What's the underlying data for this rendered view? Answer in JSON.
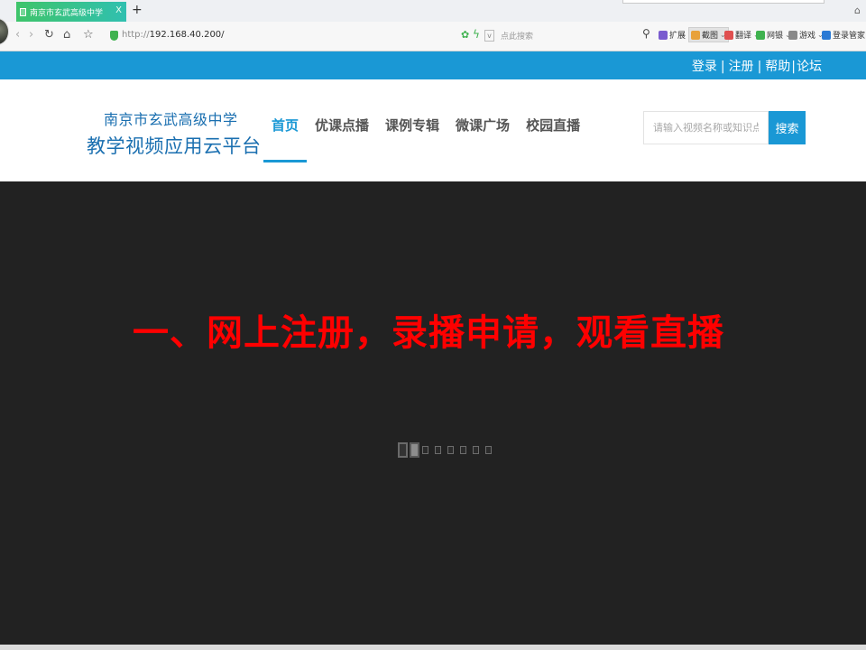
{
  "browser": {
    "tab_title": "南京市玄武高级中学",
    "tab_close": "X",
    "new_tab": "+",
    "address_protocol": "http://",
    "address_host": "192.168.40.200/",
    "search_placeholder": "点此搜索",
    "toolbar": [
      {
        "label": "扩展",
        "color": "#7a5ccf",
        "icon": "puzzle-icon"
      },
      {
        "label": "截图",
        "color": "#e8a13a",
        "icon": "scissors-icon",
        "highlighted": true
      },
      {
        "label": "翻译",
        "color": "#e05050",
        "icon": "translate-icon"
      },
      {
        "label": "网银",
        "color": "#3fb24f",
        "icon": "bank-shield-icon"
      },
      {
        "label": "游戏",
        "color": "#8a8a8a",
        "icon": "game-icon"
      },
      {
        "label": "登录管家",
        "color": "#2a7ad5",
        "icon": "key-icon"
      }
    ]
  },
  "site": {
    "top_links": [
      "登录",
      "注册",
      "帮助",
      "论坛"
    ],
    "logo_line1": "南京市玄武高级中学",
    "logo_line2": "教学视频应用云平台",
    "nav": [
      {
        "label": "首页",
        "active": true
      },
      {
        "label": "优课点播",
        "active": false
      },
      {
        "label": "课例专辑",
        "active": false
      },
      {
        "label": "微课广场",
        "active": false
      },
      {
        "label": "校园直播",
        "active": false
      }
    ],
    "search": {
      "placeholder": "请输入视频名称或知识点",
      "button": "搜索"
    },
    "colors": {
      "brand_blue": "#1a98d5",
      "logo_blue": "#1a6fb0",
      "banner_bg": "#222222",
      "caption_red": "#ff0000"
    }
  },
  "banner": {
    "caption": "一、网上注册，录播申请，观看直播",
    "slide_count": 8,
    "active_slide": 2
  }
}
